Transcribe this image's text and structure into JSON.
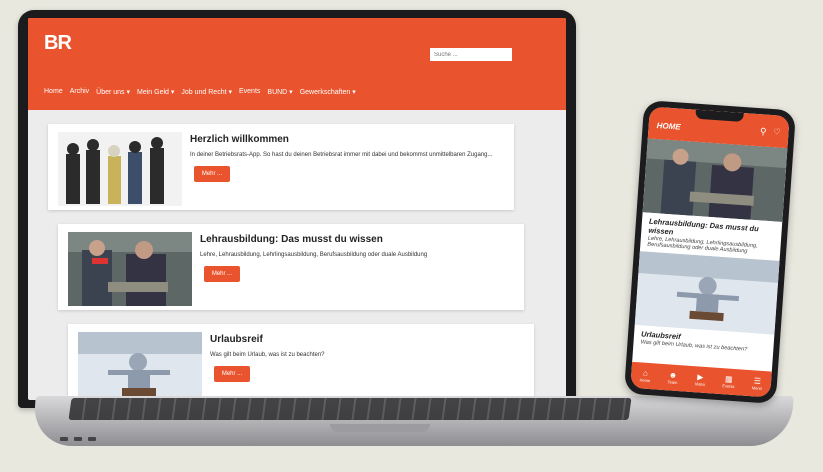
{
  "site": {
    "logo": "BR",
    "search_placeholder": "Suche ...",
    "nav": [
      "Home",
      "Archiv",
      "Über uns ▾",
      "Mein Geld ▾",
      "Job und Recht ▾",
      "Events",
      "BUND ▾",
      "Gewerkschaften ▾"
    ]
  },
  "cards": [
    {
      "title": "Herzlich willkommen",
      "text": "In deiner Betriebsrats-App. So hast du deinen Betriebsrat immer mit dabei und bekommst unmittelbaren Zugang...",
      "button": "Mehr ..."
    },
    {
      "title": "Lehrausbildung: Das musst du wissen",
      "text": "Lehre, Lehrausbildung, Lehrlingsausbildung, Berufsausbildung oder duale Ausbildung",
      "button": "Mehr ..."
    },
    {
      "title": "Urlaubsreif",
      "text": "Was gilt beim Urlaub, was ist zu beachten?",
      "button": "Mehr ..."
    }
  ],
  "phone": {
    "title": "HOME",
    "items": [
      {
        "title": "Lehrausbildung: Das musst du wissen",
        "text": "Lehre, Lehrausbildung, Lehrlingsausbildung, Berufsausbildung oder duale Ausbildung"
      },
      {
        "title": "Urlaubsreif",
        "text": "Was gilt beim Urlaub, was ist zu beachten?"
      }
    ],
    "tabs": [
      "Home",
      "Team",
      "Video",
      "Events",
      "Menü"
    ]
  },
  "colors": {
    "accent": "#e9532d"
  }
}
